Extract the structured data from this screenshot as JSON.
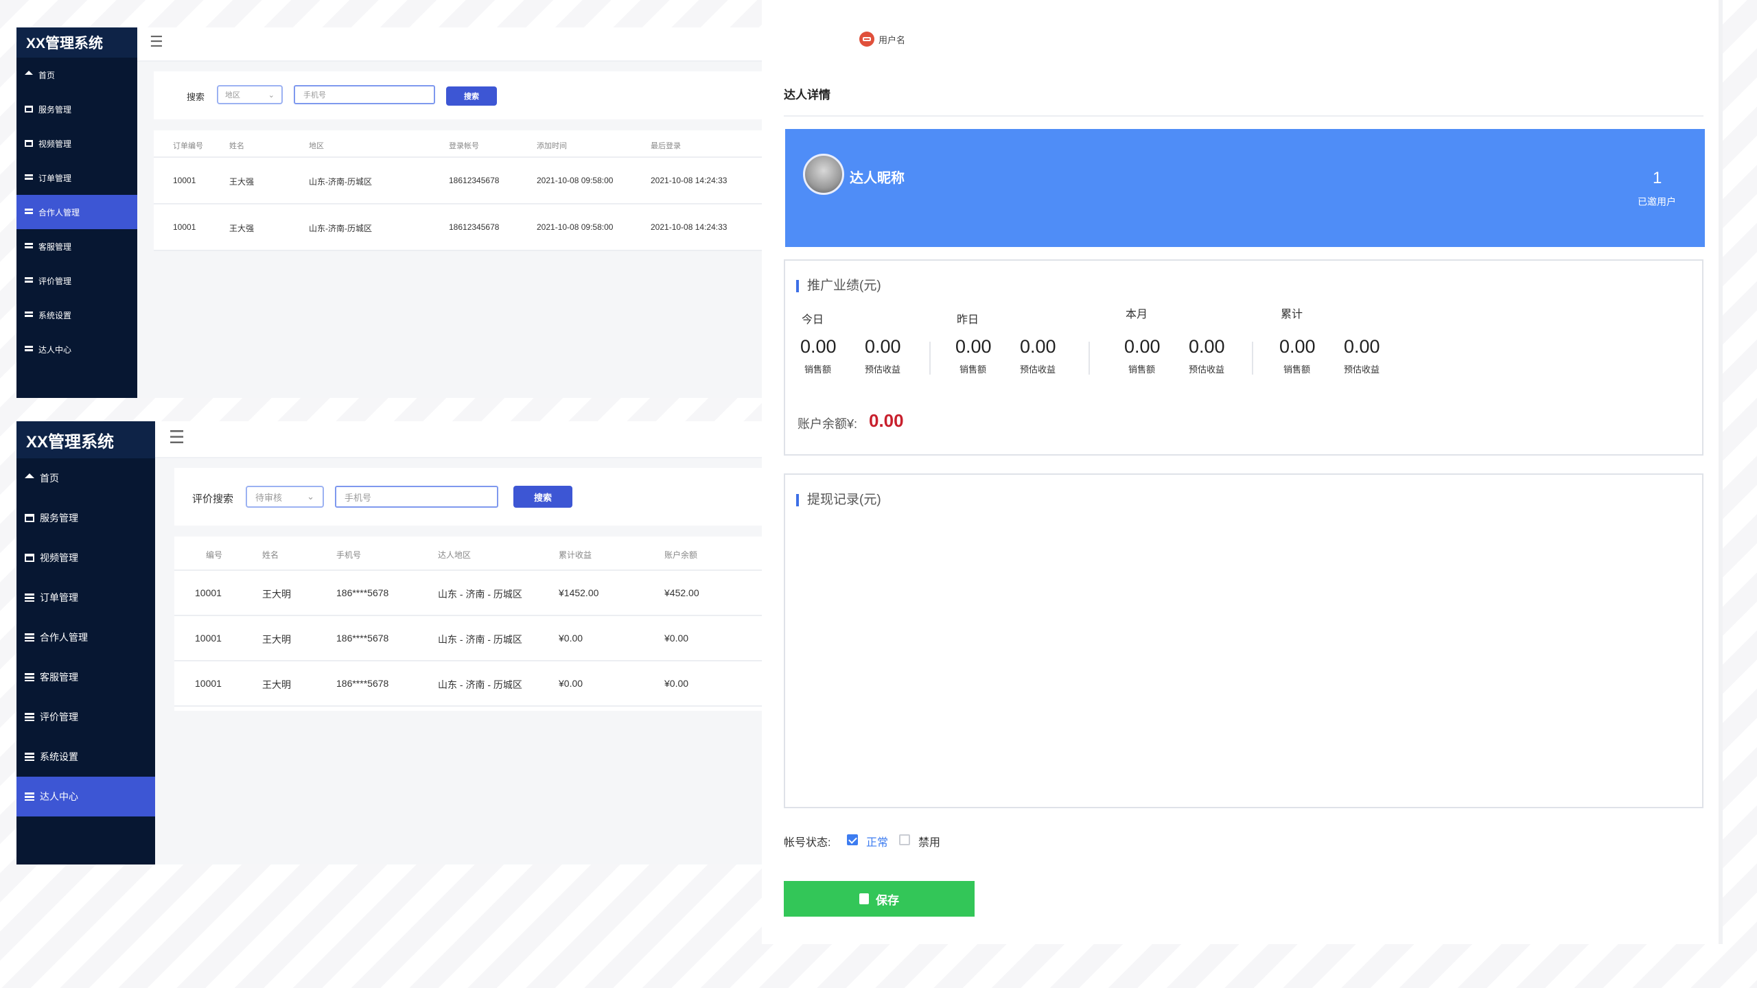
{
  "panel1": {
    "brand": "XX管理系统",
    "nav": [
      {
        "label": "首页",
        "icon": "home-icon",
        "active": false
      },
      {
        "label": "服务管理",
        "icon": "store-icon",
        "active": false
      },
      {
        "label": "视频管理",
        "icon": "store-icon",
        "active": false
      },
      {
        "label": "订单管理",
        "icon": "list-icon",
        "active": false
      },
      {
        "label": "合作人管理",
        "icon": "list-icon",
        "active": true
      },
      {
        "label": "客服管理",
        "icon": "list-icon",
        "active": false
      },
      {
        "label": "评价管理",
        "icon": "list-icon",
        "active": false
      },
      {
        "label": "系统设置",
        "icon": "list-icon",
        "active": false
      },
      {
        "label": "达人中心",
        "icon": "list-icon",
        "active": false
      }
    ],
    "search": {
      "label": "搜索",
      "region_select": "地区",
      "phone_placeholder": "手机号",
      "button": "搜索"
    },
    "columns": [
      "订单编号",
      "姓名",
      "地区",
      "登录帐号",
      "添加时间",
      "最后登录"
    ],
    "rows": [
      [
        "10001",
        "王大强",
        "山东-济南-历城区",
        "18612345678",
        "2021-10-08 09:58:00",
        "2021-10-08 14:24:33"
      ],
      [
        "10001",
        "王大强",
        "山东-济南-历城区",
        "18612345678",
        "2021-10-08 09:58:00",
        "2021-10-08 14:24:33"
      ]
    ]
  },
  "panel2": {
    "brand": "XX管理系统",
    "nav": [
      {
        "label": "首页",
        "icon": "home-icon",
        "active": false
      },
      {
        "label": "服务管理",
        "icon": "store-icon",
        "active": false
      },
      {
        "label": "视频管理",
        "icon": "store-icon",
        "active": false
      },
      {
        "label": "订单管理",
        "icon": "list-icon",
        "active": false
      },
      {
        "label": "合作人管理",
        "icon": "list-icon",
        "active": false
      },
      {
        "label": "客服管理",
        "icon": "list-icon",
        "active": false
      },
      {
        "label": "评价管理",
        "icon": "list-icon",
        "active": false
      },
      {
        "label": "系统设置",
        "icon": "list-icon",
        "active": false
      },
      {
        "label": "达人中心",
        "icon": "list-icon",
        "active": true
      }
    ],
    "search": {
      "label": "评价搜索",
      "status_select": "待审核",
      "phone_placeholder": "手机号",
      "button": "搜索"
    },
    "columns": [
      "编号",
      "姓名",
      "手机号",
      "达人地区",
      "累计收益",
      "账户余额"
    ],
    "rows": [
      [
        "10001",
        "王大明",
        "186****5678",
        "山东 - 济南 - 历城区",
        "¥1452.00",
        "¥452.00"
      ],
      [
        "10001",
        "王大明",
        "186****5678",
        "山东 - 济南 - 历城区",
        "¥0.00",
        "¥0.00"
      ],
      [
        "10001",
        "王大明",
        "186****5678",
        "山东 - 济南 - 历城区",
        "¥0.00",
        "¥0.00"
      ]
    ]
  },
  "detail": {
    "username": "用户名",
    "title": "达人详情",
    "nickname": "达人昵称",
    "invited_count": "1",
    "invited_label": "已邀用户",
    "promo_title": "推广业绩(元)",
    "periods": [
      {
        "name": "今日",
        "sales": "0.00",
        "income": "0.00"
      },
      {
        "name": "昨日",
        "sales": "0.00",
        "income": "0.00"
      },
      {
        "name": "本月",
        "sales": "0.00",
        "income": "0.00"
      },
      {
        "name": "累计",
        "sales": "0.00",
        "income": "0.00"
      }
    ],
    "sales_label": "销售额",
    "income_label": "预估收益",
    "balance_label": "账户余额¥:",
    "balance_value": "0.00",
    "withdraw_title": "提现记录(元)",
    "status_label": "帐号状态:",
    "status_normal": "正常",
    "status_disabled": "禁用",
    "save": "保存"
  },
  "colors": {
    "sidebar": "#071732",
    "active": "#3d56d4",
    "hero": "#4f8df7",
    "save": "#33c658",
    "balance": "#c8202d"
  }
}
